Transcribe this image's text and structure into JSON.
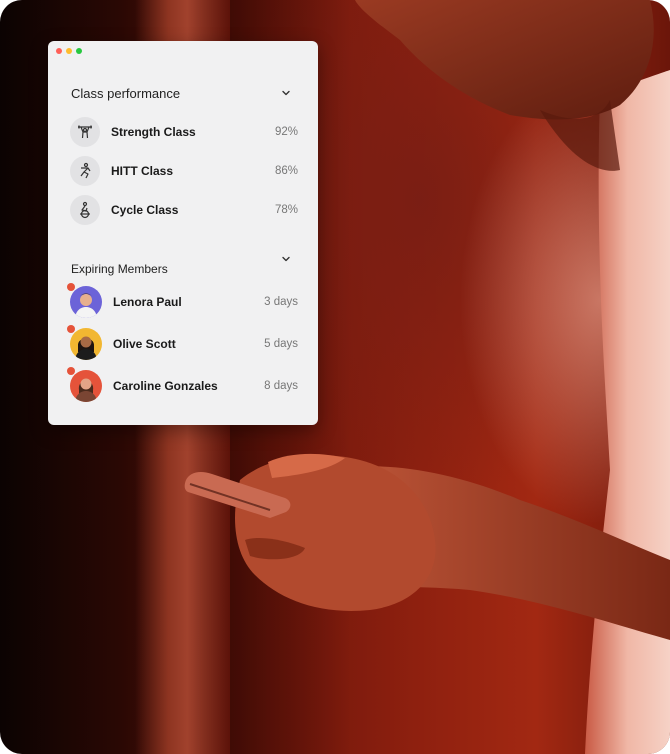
{
  "window_controls": {
    "colors": [
      "#ff5f57",
      "#febc2e",
      "#28c840"
    ]
  },
  "class_performance": {
    "title": "Class performance",
    "items": [
      {
        "name": "Strength Class",
        "value": "92%",
        "icon": "weightlifting-icon"
      },
      {
        "name": "HITT Class",
        "value": "86%",
        "icon": "running-icon"
      },
      {
        "name": "Cycle Class",
        "value": "78%",
        "icon": "cycling-icon"
      }
    ]
  },
  "expiring_members": {
    "title": "Expiring Members",
    "items": [
      {
        "name": "Lenora Paul",
        "value": "3 days",
        "avatar_color": "#6c63d8"
      },
      {
        "name": "Olive Scott",
        "value": "5 days",
        "avatar_color": "#f2b731"
      },
      {
        "name": "Caroline Gonzales",
        "value": "8 days",
        "avatar_color": "#e5533a"
      }
    ],
    "badge_color": "#e5533a"
  }
}
